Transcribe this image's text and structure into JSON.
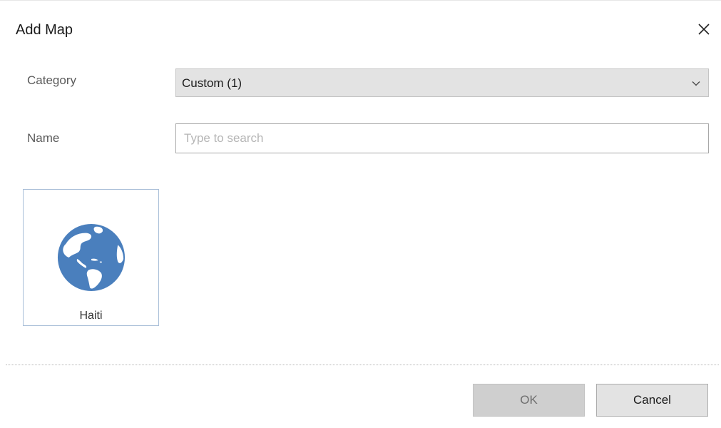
{
  "dialog": {
    "title": "Add Map"
  },
  "form": {
    "category_label": "Category",
    "category_value": "Custom (1)",
    "name_label": "Name",
    "name_value": "",
    "name_placeholder": "Type to search"
  },
  "maps": [
    {
      "label": "Haiti",
      "icon": "globe-icon"
    }
  ],
  "footer": {
    "ok_label": "OK",
    "cancel_label": "Cancel"
  },
  "colors": {
    "globe_blue": "#4a7fbd",
    "tile_border": "#a9bfd8"
  }
}
